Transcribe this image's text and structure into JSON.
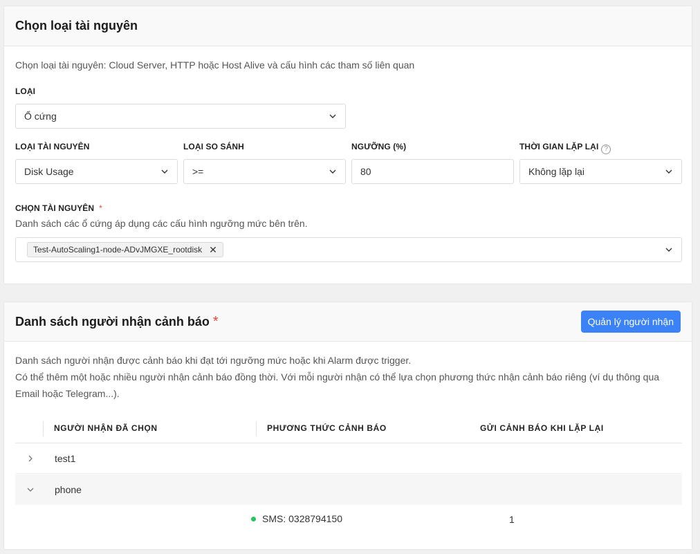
{
  "resource_card": {
    "title": "Chọn loại tài nguyên",
    "description": "Chọn loại tài nguyên: Cloud Server, HTTP hoặc Host Alive và cấu hình các tham số liên quan",
    "type_label": "LOẠI",
    "type_value": "Ổ cứng",
    "resource_type_label": "LOẠI TÀI NGUYÊN",
    "resource_type_value": "Disk Usage",
    "compare_label": "LOẠI SO SÁNH",
    "compare_value": ">=",
    "threshold_label": "NGƯỠNG (%)",
    "threshold_value": "80",
    "repeat_label": "THỜI GIAN LẶP LẠI",
    "repeat_value": "Không lặp lại",
    "select_resource_label": "CHỌN TÀI NGUYÊN",
    "required_mark": "*",
    "select_resource_hint": "Danh sách các ổ cứng áp dụng các cấu hình ngưỡng mức bên trên.",
    "selected_tags": [
      "Test-AutoScaling1-node-ADvJMGXE_rootdisk"
    ]
  },
  "recipients_card": {
    "title": "Danh sách người nhận cảnh báo",
    "required_mark": "*",
    "manage_button": "Quản lý người nhận",
    "description_line1": "Danh sách người nhận được cảnh báo khi đạt tới ngưỡng mức hoặc khi Alarm được trigger.",
    "description_line2": "Có thể thêm một hoặc nhiều người nhận cảnh báo đồng thời. Với mỗi người nhận có thể lựa chọn phương thức nhận cảnh báo riêng (ví dụ thông qua Email hoặc Telegram...).",
    "columns": [
      "NGƯỜI NHẬN ĐÃ CHỌN",
      "PHƯƠNG THỨC CẢNH BÁO",
      "GỬI CẢNH BÁO KHI LẶP LẠI"
    ],
    "rows": [
      {
        "name": "test1",
        "expanded": false
      },
      {
        "name": "phone",
        "expanded": true
      }
    ],
    "detail": {
      "method": "SMS: 0328794150",
      "repeat": "1",
      "status_color": "#22c55e"
    }
  },
  "colors": {
    "accent": "#3b82f6",
    "required": "#e5453b"
  }
}
